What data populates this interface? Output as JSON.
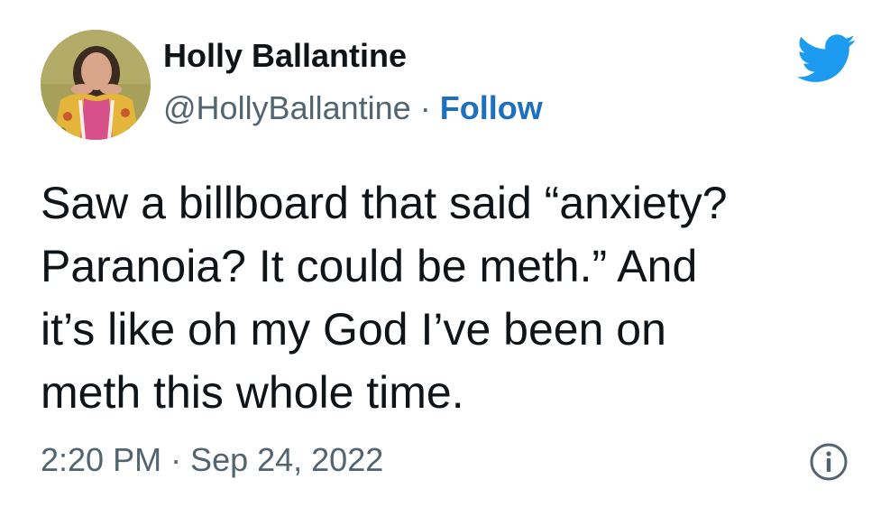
{
  "tweet": {
    "author": {
      "display_name": "Holly Ballantine",
      "handle": "@HollyBallantine",
      "separator": "·",
      "follow_label": "Follow",
      "avatar_icon": "avatar-photo"
    },
    "text": "Saw a billboard that said “anxiety?\nParanoia? It could be meth.” And\nit’s like oh my God I’ve been on\nmeth this whole time.",
    "timestamp": "2:20 PM · Sep 24, 2022",
    "icons": {
      "brand": "twitter-bird-icon",
      "info": "info-icon"
    }
  },
  "colors": {
    "twitter_blue": "#1d9bf0",
    "follow_link": "#1d6fbf",
    "text_primary": "#0f1419",
    "text_secondary": "#536471"
  }
}
